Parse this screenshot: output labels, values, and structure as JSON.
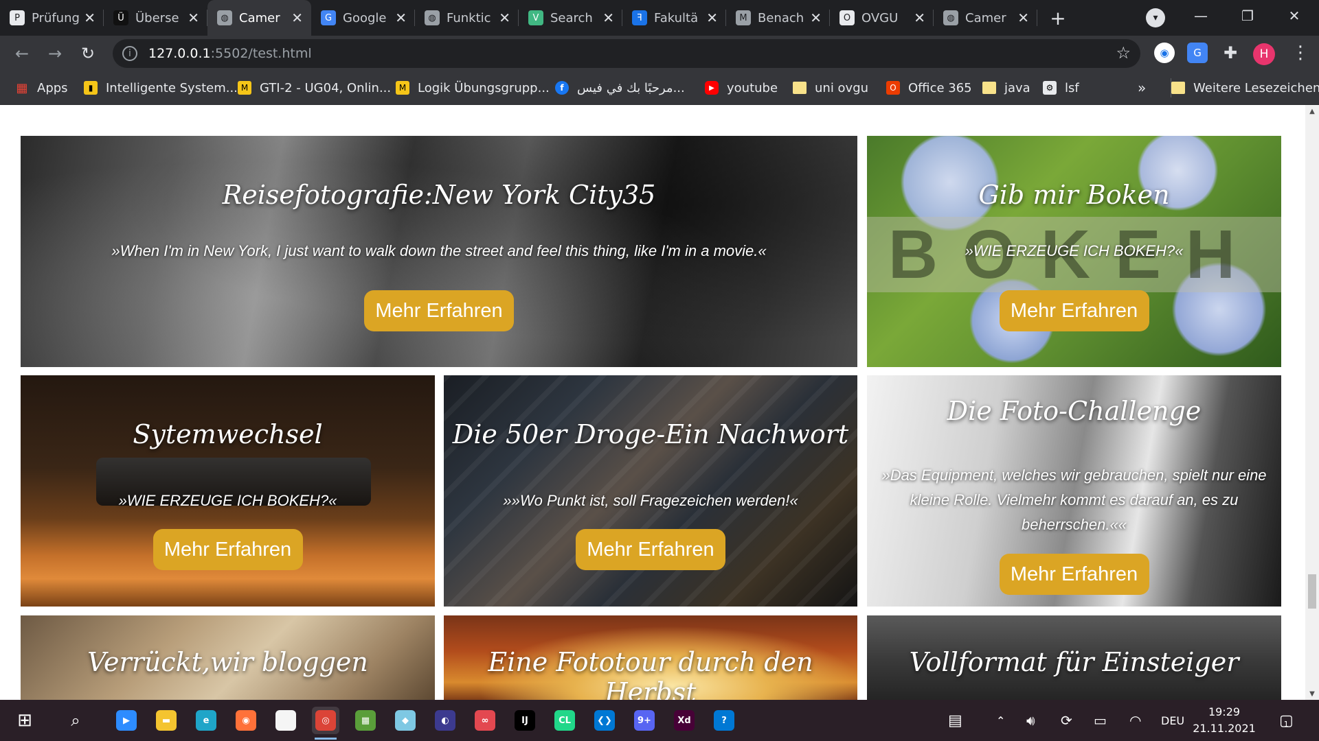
{
  "browser": {
    "tabs": [
      {
        "title": "Prüfung",
        "icon": "prufung-icon",
        "color": "#e8eaed",
        "glyph": "P"
      },
      {
        "title": "Überse",
        "icon": "ubersetzung-icon",
        "color": "#111111",
        "glyph": "Ü"
      },
      {
        "title": "Camer",
        "icon": "globe-icon",
        "color": "#9aa0a6",
        "glyph": "◍",
        "active": true
      },
      {
        "title": "Google",
        "icon": "google-translate-icon",
        "color": "#4285f4",
        "glyph": "G"
      },
      {
        "title": "Funktic",
        "icon": "globe-icon",
        "color": "#9aa0a6",
        "glyph": "◍"
      },
      {
        "title": "Search",
        "icon": "vue-icon",
        "color": "#41b883",
        "glyph": "V"
      },
      {
        "title": "Fakultä",
        "icon": "fakultat-icon",
        "color": "#1a73e8",
        "glyph": "ꟻ"
      },
      {
        "title": "Benach",
        "icon": "moodle-icon",
        "color": "#9aa0a6",
        "glyph": "M"
      },
      {
        "title": "OVGU",
        "icon": "ovgu-icon",
        "color": "#e8eaed",
        "glyph": "O"
      },
      {
        "title": "Camer",
        "icon": "globe-icon",
        "color": "#9aa0a6",
        "glyph": "◍"
      }
    ],
    "new_tab": "+",
    "close": "✕",
    "url_host": "127.0.0.1",
    "url_rest": ":5502/test.html",
    "profile_initial": "H",
    "bookmarks": [
      {
        "label": "Apps",
        "type": "apps"
      },
      {
        "label": "Intelligente System...",
        "type": "icon",
        "color": "#f5c518"
      },
      {
        "label": "GTI-2 - UG04, Onlin...",
        "type": "icon",
        "color": "#f5c518"
      },
      {
        "label": "Logik Übungsgrupp...",
        "type": "icon",
        "color": "#f5c518"
      },
      {
        "label": "مرحبًا بك في فيس...",
        "type": "icon",
        "color": "#1877f2"
      },
      {
        "label": "youtube",
        "type": "icon",
        "color": "#ff0000"
      },
      {
        "label": "uni ovgu",
        "type": "folder"
      },
      {
        "label": "Office 365",
        "type": "icon",
        "color": "#eb3c00"
      },
      {
        "label": "java",
        "type": "folder"
      },
      {
        "label": "lsf",
        "type": "icon",
        "color": "#e8eaed"
      }
    ],
    "more_bookmarks": "»",
    "other_bookmarks": "Weitere Lesezeichen"
  },
  "cards": [
    {
      "title": "Reisefotografie:New York City35",
      "quote": "»When I'm in New York, I just want to walk down the street and feel this thing, like I'm in a movie.«",
      "button": "Mehr Erfahren"
    },
    {
      "title": "Gib mir Boken",
      "quote": "»WIE ERZEUGE ICH BOKEH?«",
      "button": "Mehr Erfahren"
    },
    {
      "title": "Sytemwechsel",
      "quote": "»WIE ERZEUGE ICH BOKEH?«",
      "button": "Mehr Erfahren"
    },
    {
      "title": "Die 50er Droge-Ein Nachwort",
      "quote": "»»Wo Punkt ist, soll Fragezeichen werden!«",
      "button": "Mehr Erfahren"
    },
    {
      "title": "Die Foto-Challenge",
      "quote": "»Das Equipment, welches wir gebrauchen, spielt nur eine kleine Rolle. Vielmehr kommt es darauf an, es zu beherrschen.««",
      "button": "Mehr Erfahren"
    },
    {
      "title": "Verrückt,wir bloggen",
      "quote": "",
      "button": ""
    },
    {
      "title": "Eine Fototour durch den Herbst",
      "quote": "",
      "button": ""
    },
    {
      "title": "Vollformat für Einsteiger",
      "quote": "",
      "button": ""
    }
  ],
  "taskbar": {
    "apps": [
      {
        "name": "zoom-icon",
        "color": "#2d8cff",
        "glyph": "▶"
      },
      {
        "name": "file-explorer-icon",
        "color": "#f4c430",
        "glyph": "▬"
      },
      {
        "name": "edge-icon",
        "color": "#1fa5c8",
        "glyph": "e"
      },
      {
        "name": "firefox-icon",
        "color": "#ff7139",
        "glyph": "◉"
      },
      {
        "name": "notepad-icon",
        "color": "#f5f5f5",
        "glyph": ""
      },
      {
        "name": "chrome-icon",
        "color": "#db4437",
        "glyph": "◎"
      },
      {
        "name": "minecraft-icon",
        "color": "#5a9e3a",
        "glyph": "▦"
      },
      {
        "name": "cube-app-icon",
        "color": "#7ec8e3",
        "glyph": "◆"
      },
      {
        "name": "eclipse-icon",
        "color": "#3c3a8f",
        "glyph": "◐"
      },
      {
        "name": "creative-cloud-icon",
        "color": "#e34850",
        "glyph": "∞"
      },
      {
        "name": "intellij-icon",
        "color": "#000000",
        "glyph": "IJ"
      },
      {
        "name": "clion-icon",
        "color": "#21d789",
        "glyph": "CL"
      },
      {
        "name": "vscode-icon",
        "color": "#0078d4",
        "glyph": "❮❯"
      },
      {
        "name": "discord-icon",
        "color": "#5865f2",
        "glyph": "9+"
      },
      {
        "name": "adobe-xd-icon",
        "color": "#470137",
        "glyph": "Xd"
      },
      {
        "name": "help-icon",
        "color": "#0078d4",
        "glyph": "?"
      }
    ],
    "language": "DEU",
    "time": "19:29",
    "date": "21.11.2021",
    "notifications": "1"
  }
}
